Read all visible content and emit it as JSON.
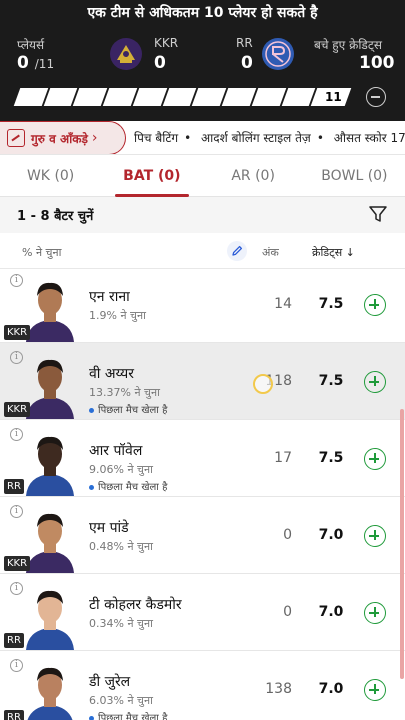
{
  "header": {
    "title": "एक टीम से अधिकतम 10 प्लेयर हो सकते है",
    "players_label": "प्लेयर्स",
    "players_count": "0",
    "players_total": "/11",
    "team1_name": "KKR",
    "team1_count": "0",
    "team2_name": "RR",
    "team2_count": "0",
    "credits_label": "बचे हुए क्रेडिट्स",
    "credits_left": "100",
    "progress_last": "11",
    "progress_segments": 11,
    "colors": {
      "bg": "#1b1b1b",
      "accent": "#b3262d",
      "add": "#1f9a3a"
    }
  },
  "strip": {
    "guru_label": "गुरु व आँकड़े",
    "items": [
      "पिच बैटिंग",
      "आदर्श बोलिंग स्टाइल तेज़",
      "औसत स्कोर 17"
    ]
  },
  "tabs": [
    {
      "label": "WK (0)",
      "active": false
    },
    {
      "label": "BAT (0)",
      "active": true
    },
    {
      "label": "AR (0)",
      "active": false
    },
    {
      "label": "BOWL (0)",
      "active": false
    }
  ],
  "select_text": "1 - 8 बैटर चुनें",
  "columns": {
    "selected_by": "% ने चुना",
    "points": "अंक",
    "credits": "क्रेडिट्स ↓"
  },
  "players": [
    {
      "name": "एन राना",
      "pct": "1.9% ने चुना",
      "team": "KKR",
      "points": "14",
      "credits": "7.5",
      "played": "",
      "highlight": false,
      "skin": "#b07a55",
      "jersey": "#3b2a63"
    },
    {
      "name": "वी अय्यर",
      "pct": "13.37% ने चुना",
      "team": "KKR",
      "points": "118",
      "credits": "7.5",
      "played": "पिछला मैच खेला है",
      "highlight": true,
      "skin": "#8a5a3c",
      "jersey": "#3b2a63"
    },
    {
      "name": "आर पॉवेल",
      "pct": "9.06% ने चुना",
      "team": "RR",
      "points": "17",
      "credits": "7.5",
      "played": "पिछला मैच खेला है",
      "highlight": false,
      "skin": "#3e2a20",
      "jersey": "#2a4fa0"
    },
    {
      "name": "एम पांडे",
      "pct": "0.48% ने चुना",
      "team": "KKR",
      "points": "0",
      "credits": "7.0",
      "played": "",
      "highlight": false,
      "skin": "#c08a62",
      "jersey": "#3b2a63"
    },
    {
      "name": "टी कोहलर कैडमोर",
      "pct": "0.34% ने चुना",
      "team": "RR",
      "points": "0",
      "credits": "7.0",
      "played": "",
      "highlight": false,
      "skin": "#e2b595",
      "jersey": "#2a4fa0"
    },
    {
      "name": "डी जुरेल",
      "pct": "6.03% ने चुना",
      "team": "RR",
      "points": "138",
      "credits": "7.0",
      "played": "पिछला मैच खेला है",
      "highlight": false,
      "skin": "#b98160",
      "jersey": "#2a4fa0"
    }
  ]
}
